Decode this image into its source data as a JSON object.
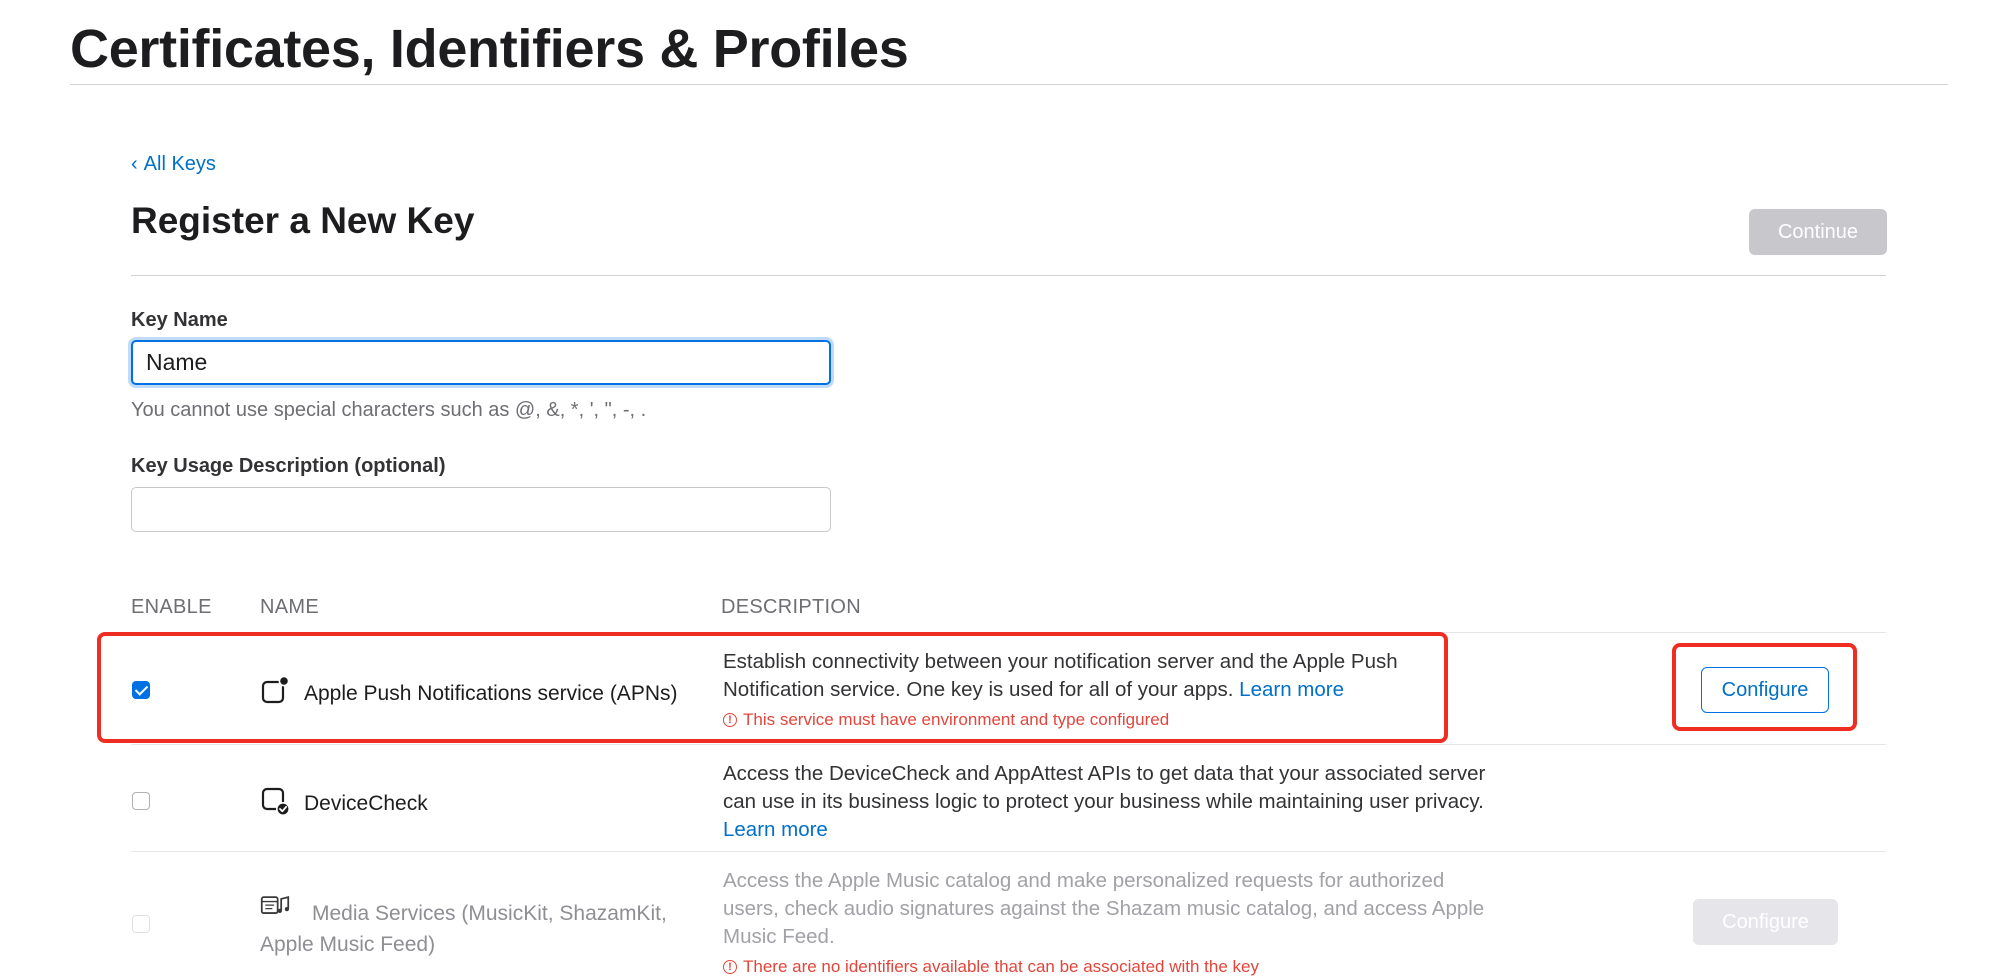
{
  "header": {
    "title": "Certificates, Identifiers & Profiles"
  },
  "nav": {
    "back_chevron": "‹",
    "back_label": "All Keys"
  },
  "section": {
    "title": "Register a New Key",
    "continue_label": "Continue"
  },
  "form": {
    "key_name": {
      "label": "Key Name",
      "value": "Name",
      "hint": "You cannot use special characters such as @, &, *, ', \", -, ."
    },
    "usage_description": {
      "label": "Key Usage Description (optional)",
      "value": ""
    }
  },
  "table": {
    "headers": {
      "enable": "ENABLE",
      "name": "NAME",
      "description": "DESCRIPTION"
    },
    "rows": [
      {
        "enabled": true,
        "icon": "push-notification-icon",
        "name": "Apple Push Notifications service (APNs)",
        "description": "Establish connectivity between your notification server and the Apple Push Notification service. One key is used for all of your apps.",
        "learn_more": "Learn more",
        "warning": "This service must have environment and type configured",
        "configure_label": "Configure"
      },
      {
        "enabled": false,
        "icon": "device-check-icon",
        "name": "DeviceCheck",
        "description": "Access the DeviceCheck and AppAttest APIs to get data that your associated server can use in its business logic to protect your business while maintaining user privacy.",
        "learn_more": "Learn more"
      },
      {
        "enabled": false,
        "disabled": true,
        "icon": "media-services-icon",
        "name": "Media Services (MusicKit, ShazamKit, Apple Music Feed)",
        "description": "Access the Apple Music catalog and make personalized requests for authorized users, check audio signatures against the Shazam music catalog, and access Apple Music Feed.",
        "warning": "There are no identifiers available that can be associated with the key",
        "configure_label": "Configure"
      }
    ]
  },
  "colors": {
    "accent": "#0071e3",
    "link": "#0070c9",
    "warning": "#e3453b",
    "highlight": "#f02d22"
  }
}
